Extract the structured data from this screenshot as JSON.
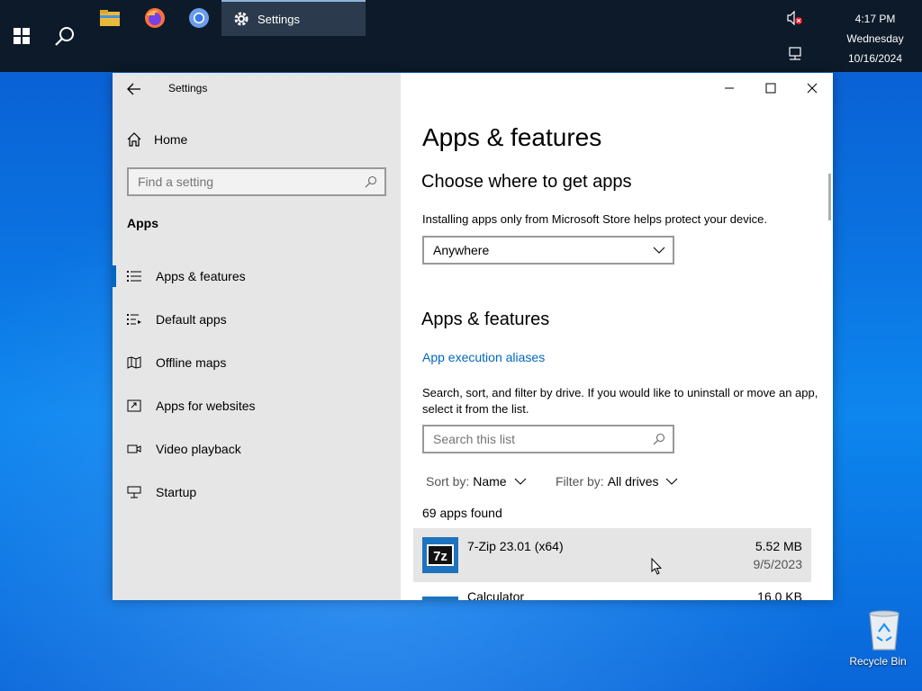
{
  "taskbar": {
    "settings_task_label": "Settings",
    "clock": {
      "time": "4:17 PM",
      "day": "Wednesday",
      "date": "10/16/2024"
    }
  },
  "window": {
    "title": "Settings",
    "nav": {
      "home_label": "Home",
      "search_placeholder": "Find a setting",
      "section": "Apps",
      "items": [
        {
          "label": "Apps & features",
          "icon": "list-icon",
          "active": true
        },
        {
          "label": "Default apps",
          "icon": "default-list-icon"
        },
        {
          "label": "Offline maps",
          "icon": "map-icon"
        },
        {
          "label": "Apps for websites",
          "icon": "open-link-icon"
        },
        {
          "label": "Video playback",
          "icon": "video-icon"
        },
        {
          "label": "Startup",
          "icon": "startup-icon"
        }
      ]
    },
    "content": {
      "page_title": "Apps & features",
      "choose_heading": "Choose where to get apps",
      "choose_desc": "Installing apps only from Microsoft Store helps protect your device.",
      "dropdown_value": "Anywhere",
      "features_heading": "Apps & features",
      "aliases_link": "App execution aliases",
      "search_desc": "Search, sort, and filter by drive. If you would like to uninstall or move an app, select it from the list.",
      "search_placeholder": "Search this list",
      "sort_key": "Sort by:",
      "sort_value": "Name",
      "filter_key": "Filter by:",
      "filter_value": "All drives",
      "count": "69 apps found",
      "apps": [
        {
          "name": "7-Zip 23.01 (x64)",
          "size": "5.52 MB",
          "date": "9/5/2023",
          "selected": true
        },
        {
          "name": "Calculator",
          "size": "16.0 KB",
          "date": ""
        }
      ]
    }
  },
  "desktop": {
    "recycle_bin_label": "Recycle Bin"
  },
  "colors": {
    "accent": "#0067c0",
    "taskbar": "#0c1a2a",
    "nav_bg": "#e6e6e6"
  }
}
